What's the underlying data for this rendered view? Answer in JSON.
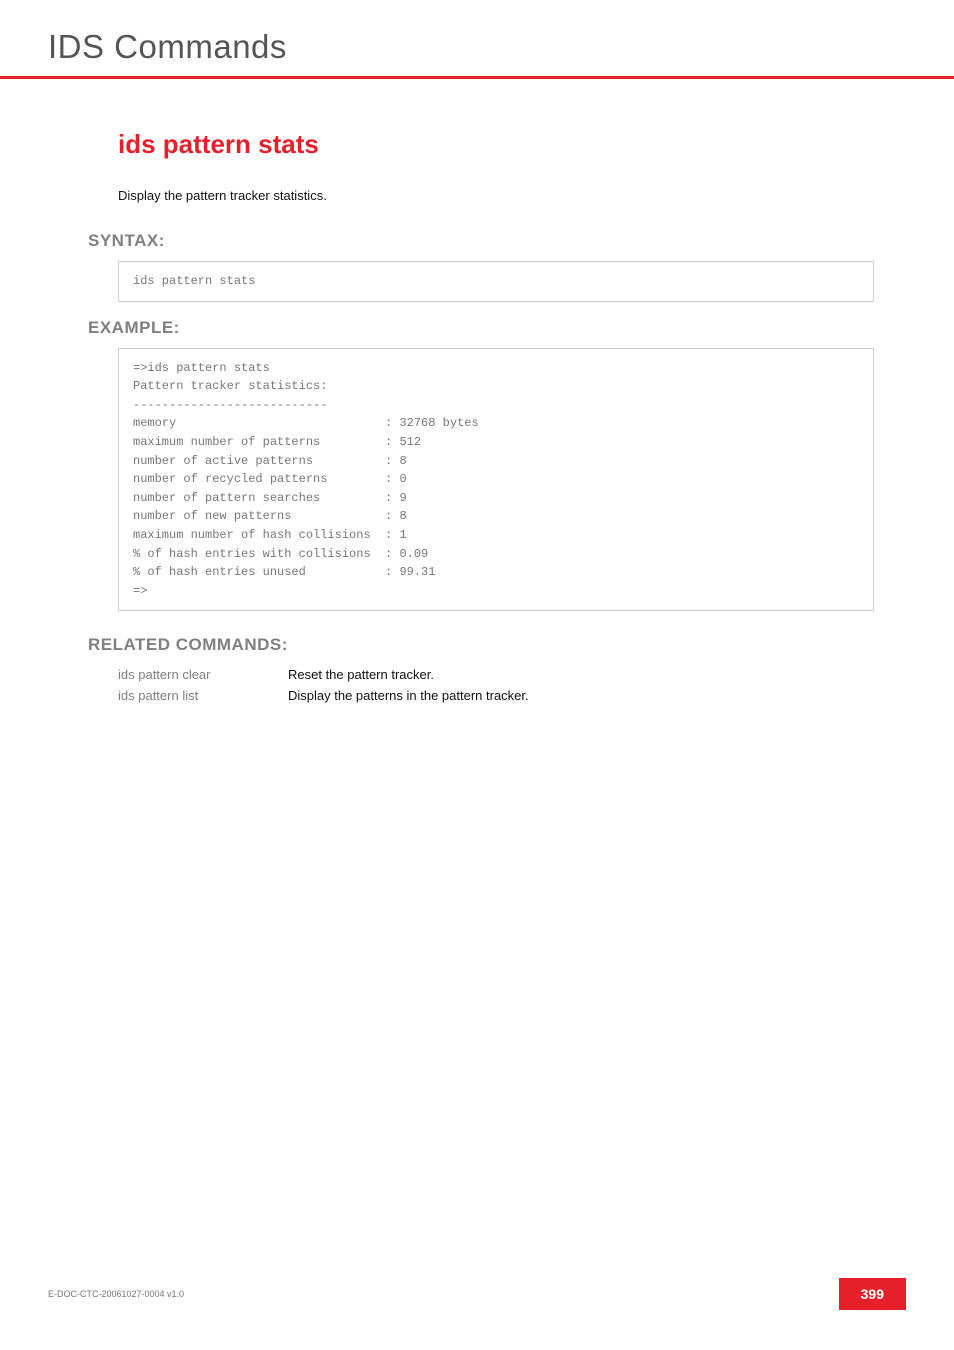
{
  "header": {
    "title": "IDS Commands"
  },
  "section": {
    "title": "ids pattern stats",
    "description": "Display the pattern tracker statistics."
  },
  "syntax": {
    "heading": "SYNTAX:",
    "code": "ids pattern stats"
  },
  "example": {
    "heading": "EXAMPLE:",
    "code": "=>ids pattern stats\nPattern tracker statistics:\n---------------------------\nmemory                             : 32768 bytes\nmaximum number of patterns         : 512\nnumber of active patterns          : 8\nnumber of recycled patterns        : 0\nnumber of pattern searches         : 9\nnumber of new patterns             : 8\nmaximum number of hash collisions  : 1\n% of hash entries with collisions  : 0.09\n% of hash entries unused           : 99.31\n=>"
  },
  "related": {
    "heading": "RELATED COMMANDS:",
    "items": [
      {
        "cmd": "ids pattern clear",
        "desc": "Reset the pattern tracker."
      },
      {
        "cmd": "ids pattern list",
        "desc": "Display the patterns in the pattern tracker."
      }
    ]
  },
  "footer": {
    "docid": "E-DOC-CTC-20061027-0004 v1.0",
    "page": "399"
  }
}
